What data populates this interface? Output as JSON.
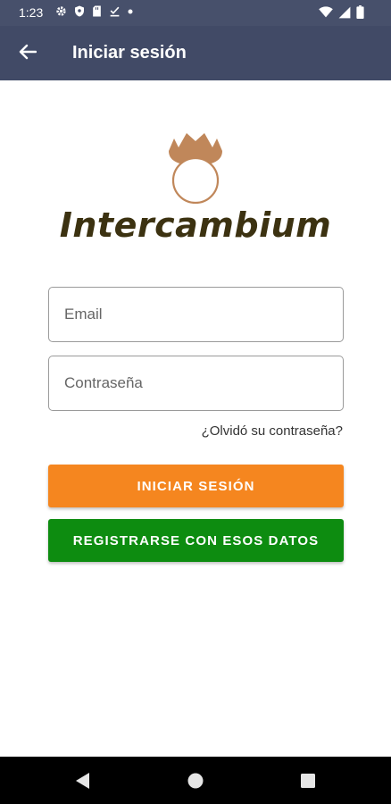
{
  "status_bar": {
    "time": "1:23",
    "left_icons": [
      "gear-icon",
      "shield-icon",
      "sim-card-icon",
      "download-done-icon",
      "dot-icon"
    ],
    "right_icons": [
      "wifi-icon",
      "signal-icon",
      "battery-icon"
    ]
  },
  "app_bar": {
    "title": "Iniciar sesión",
    "back_icon": "arrow-left-icon",
    "background": "#414a66"
  },
  "brand": {
    "name": "Intercambium",
    "logo_color": "#c0875a",
    "text_color": "#3c3211"
  },
  "form": {
    "email_placeholder": "Email",
    "email_value": "",
    "password_placeholder": "Contraseña",
    "password_value": "",
    "forgot_password": "¿Olvidó su contraseña?"
  },
  "buttons": {
    "login": {
      "label": "INICIAR SESIÓN",
      "color": "#f5861f"
    },
    "register": {
      "label": "REGISTRARSE CON ESOS DATOS",
      "color": "#0d8c10"
    }
  },
  "nav_bar": {
    "icons": [
      "back-triangle-icon",
      "home-circle-icon",
      "recents-square-icon"
    ]
  }
}
